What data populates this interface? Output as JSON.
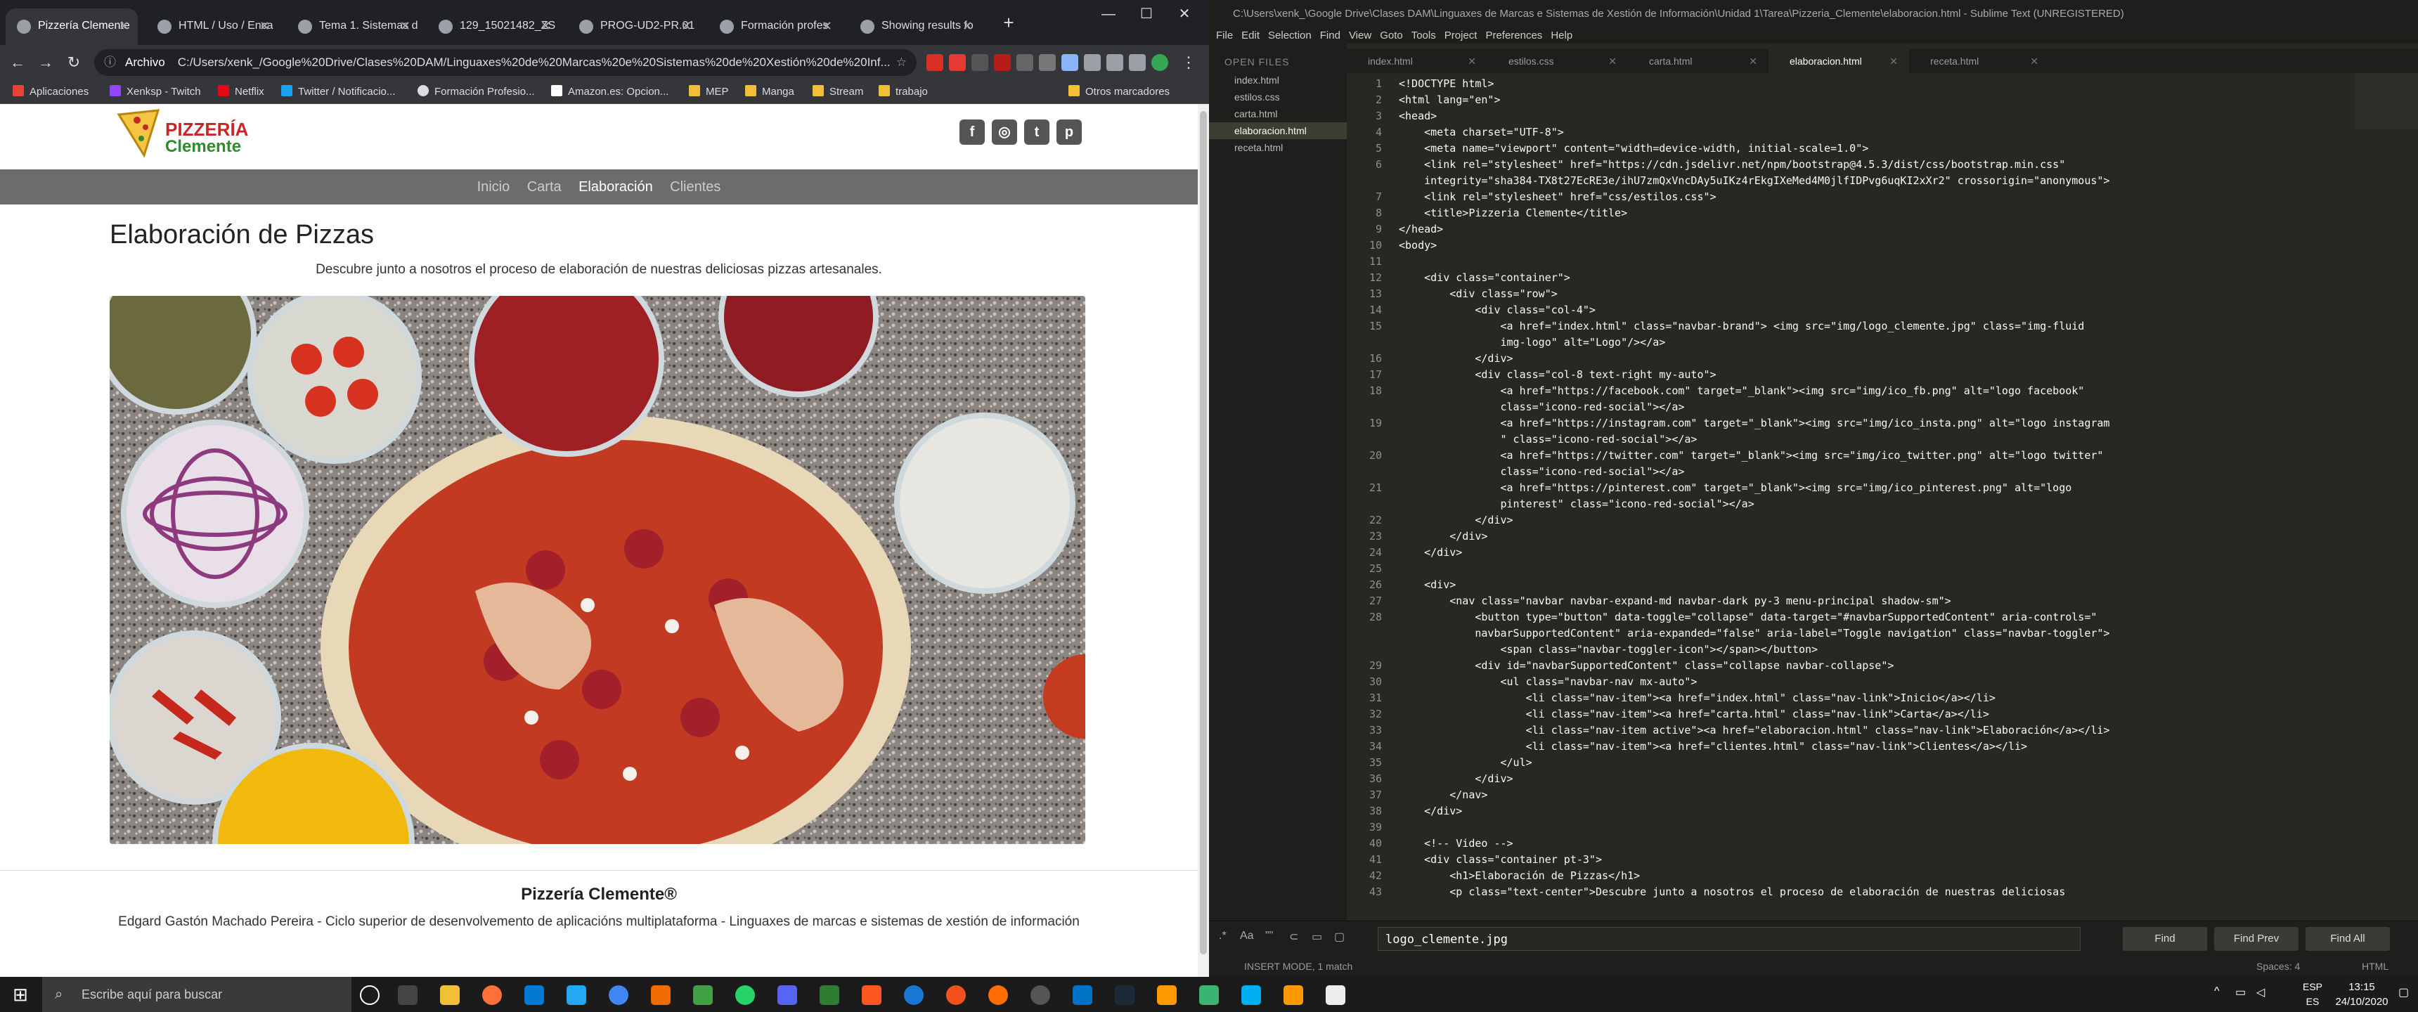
{
  "browser": {
    "tabs": [
      "Pizzería Clemente",
      "HTML / Uso / Enca",
      "Tema 1. Sistemas d",
      "129_15021482_ZS",
      "PROG-UD2-PR.01",
      "Formación profes",
      "Showing results fo"
    ],
    "address_scheme": "Archivo",
    "address": "C:/Users/xenk_/Google%20Drive/Clases%20DAM/Linguaxes%20de%20Marcas%20e%20Sistemas%20de%20Xestión%20de%20Inf...",
    "bookmarks": [
      "Aplicaciones",
      "Xenksp - Twitch",
      "Netflix",
      "Twitter / Notificacio...",
      "Formación Profesio...",
      "Amazon.es: Opcion...",
      "MEP",
      "Manga",
      "Stream",
      "trabajo"
    ],
    "other_bookmarks": "Otros marcadores",
    "window_controls": [
      "—",
      "☐",
      "✕"
    ]
  },
  "site": {
    "logo_line1": "PIZZERÍA",
    "logo_line2": "Clemente",
    "social": [
      "f",
      "◎",
      "t",
      "p"
    ],
    "menu": [
      "Inicio",
      "Carta",
      "Elaboración",
      "Clientes"
    ],
    "title": "Elaboración de Pizzas",
    "lead": "Descubre junto a nosotros el proceso de elaboración de nuestras deliciosas pizzas artesanales.",
    "footer_title": "Pizzería Clemente®",
    "footer_sub": "Edgard Gastón Machado Pereira - Ciclo superior de desenvolvemento de aplicacións multiplataforma - Linguaxes de marcas e sistemas de xestión de información"
  },
  "sublime": {
    "title": "C:\\Users\\xenk_\\Google Drive\\Clases DAM\\Linguaxes de Marcas e Sistemas de Xestión de Información\\Unidad 1\\Tarea\\Pizzeria_Clemente\\elaboracion.html - Sublime Text (UNREGISTERED)",
    "menu": [
      "File",
      "Edit",
      "Selection",
      "Find",
      "View",
      "Goto",
      "Tools",
      "Project",
      "Preferences",
      "Help"
    ],
    "open_files_header": "OPEN FILES",
    "files": [
      "index.html",
      "estilos.css",
      "carta.html",
      "elaboracion.html",
      "receta.html"
    ],
    "tabs": [
      "index.html",
      "estilos.css",
      "carta.html",
      "elaboracion.html",
      "receta.html"
    ],
    "lines": [
      {
        "n": "1",
        "t": "<!DOCTYPE html>"
      },
      {
        "n": "2",
        "t": "<html lang=\"en\">"
      },
      {
        "n": "3",
        "t": "<head>"
      },
      {
        "n": "4",
        "t": "    <meta charset=\"UTF-8\">"
      },
      {
        "n": "5",
        "t": "    <meta name=\"viewport\" content=\"width=device-width, initial-scale=1.0\">"
      },
      {
        "n": "6",
        "t": "    <link rel=\"stylesheet\" href=\"https://cdn.jsdelivr.net/npm/bootstrap@4.5.3/dist/css/bootstrap.min.css\""
      },
      {
        "n": "",
        "t": "    integrity=\"sha384-TX8t27EcRE3e/ihU7zmQxVncDAy5uIKz4rEkgIXeMed4M0jlfIDPvg6uqKI2xXr2\" crossorigin=\"anonymous\">"
      },
      {
        "n": "7",
        "t": "    <link rel=\"stylesheet\" href=\"css/estilos.css\">"
      },
      {
        "n": "8",
        "t": "    <title>Pizzeria Clemente</title>"
      },
      {
        "n": "9",
        "t": "</head>"
      },
      {
        "n": "10",
        "t": "<body>"
      },
      {
        "n": "11",
        "t": ""
      },
      {
        "n": "12",
        "t": "    <div class=\"container\">"
      },
      {
        "n": "13",
        "t": "        <div class=\"row\">"
      },
      {
        "n": "14",
        "t": "            <div class=\"col-4\">"
      },
      {
        "n": "15",
        "t": "                <a href=\"index.html\" class=\"navbar-brand\"> <img src=\"img/logo_clemente.jpg\" class=\"img-fluid"
      },
      {
        "n": "",
        "t": "                img-logo\" alt=\"Logo\"/></a>"
      },
      {
        "n": "16",
        "t": "            </div>"
      },
      {
        "n": "17",
        "t": "            <div class=\"col-8 text-right my-auto\">"
      },
      {
        "n": "18",
        "t": "                <a href=\"https://facebook.com\" target=\"_blank\"><img src=\"img/ico_fb.png\" alt=\"logo facebook\""
      },
      {
        "n": "",
        "t": "                class=\"icono-red-social\"></a>"
      },
      {
        "n": "19",
        "t": "                <a href=\"https://instagram.com\" target=\"_blank\"><img src=\"img/ico_insta.png\" alt=\"logo instagram"
      },
      {
        "n": "",
        "t": "                \" class=\"icono-red-social\"></a>"
      },
      {
        "n": "20",
        "t": "                <a href=\"https://twitter.com\" target=\"_blank\"><img src=\"img/ico_twitter.png\" alt=\"logo twitter\""
      },
      {
        "n": "",
        "t": "                class=\"icono-red-social\"></a>"
      },
      {
        "n": "21",
        "t": "                <a href=\"https://pinterest.com\" target=\"_blank\"><img src=\"img/ico_pinterest.png\" alt=\"logo"
      },
      {
        "n": "",
        "t": "                pinterest\" class=\"icono-red-social\"></a>"
      },
      {
        "n": "22",
        "t": "            </div>"
      },
      {
        "n": "23",
        "t": "        </div>"
      },
      {
        "n": "24",
        "t": "    </div>"
      },
      {
        "n": "25",
        "t": ""
      },
      {
        "n": "26",
        "t": "    <div>"
      },
      {
        "n": "27",
        "t": "        <nav class=\"navbar navbar-expand-md navbar-dark py-3 menu-principal shadow-sm\">"
      },
      {
        "n": "28",
        "t": "            <button type=\"button\" data-toggle=\"collapse\" data-target=\"#navbarSupportedContent\" aria-controls=\""
      },
      {
        "n": "",
        "t": "            navbarSupportedContent\" aria-expanded=\"false\" aria-label=\"Toggle navigation\" class=\"navbar-toggler\">"
      },
      {
        "n": "",
        "t": "                <span class=\"navbar-toggler-icon\"></span></button>"
      },
      {
        "n": "29",
        "t": "            <div id=\"navbarSupportedContent\" class=\"collapse navbar-collapse\">"
      },
      {
        "n": "30",
        "t": "                <ul class=\"navbar-nav mx-auto\">"
      },
      {
        "n": "31",
        "t": "                    <li class=\"nav-item\"><a href=\"index.html\" class=\"nav-link\">Inicio</a></li>"
      },
      {
        "n": "32",
        "t": "                    <li class=\"nav-item\"><a href=\"carta.html\" class=\"nav-link\">Carta</a></li>"
      },
      {
        "n": "33",
        "t": "                    <li class=\"nav-item active\"><a href=\"elaboracion.html\" class=\"nav-link\">Elaboración</a></li>"
      },
      {
        "n": "34",
        "t": "                    <li class=\"nav-item\"><a href=\"clientes.html\" class=\"nav-link\">Clientes</a></li>"
      },
      {
        "n": "35",
        "t": "                </ul>"
      },
      {
        "n": "36",
        "t": "            </div>"
      },
      {
        "n": "37",
        "t": "        </nav>"
      },
      {
        "n": "38",
        "t": "    </div>"
      },
      {
        "n": "39",
        "t": ""
      },
      {
        "n": "40",
        "t": "    <!-- Video -->"
      },
      {
        "n": "41",
        "t": "    <div class=\"container pt-3\">"
      },
      {
        "n": "42",
        "t": "        <h1>Elaboración de Pizzas</h1>"
      },
      {
        "n": "43",
        "t": "        <p class=\"text-center\">Descubre junto a nosotros el proceso de elaboración de nuestras deliciosas"
      }
    ],
    "find_value": "logo_clemente.jpg",
    "find_buttons": [
      "Find",
      "Find Prev",
      "Find All"
    ],
    "find_options": [
      ".*",
      "Aa",
      "\"\"",
      "⊂",
      "▭",
      "▢"
    ],
    "status_left": "INSERT MODE, 1 match",
    "status_spaces": "Spaces: 4",
    "status_syntax": "HTML"
  },
  "taskbar": {
    "search_placeholder": "Escribe aquí para buscar",
    "lang1": "ESP",
    "lang2": "ES",
    "time": "13:15",
    "date": "24/10/2020"
  }
}
